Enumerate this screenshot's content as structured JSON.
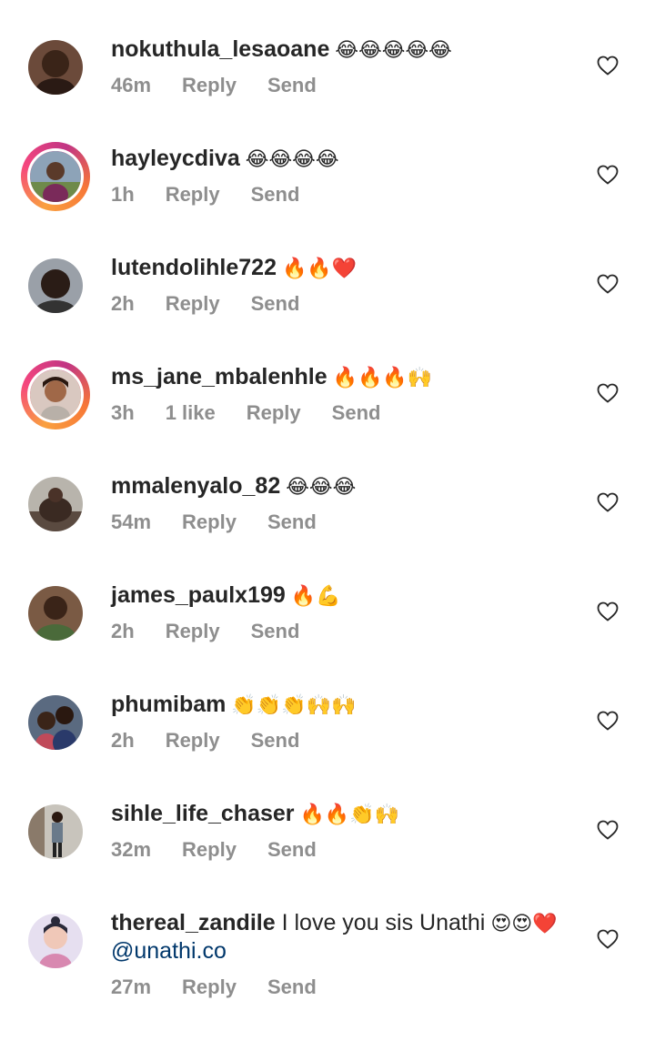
{
  "comments": [
    {
      "username": "nokuthula_lesaoane",
      "text": "",
      "emojis": "😂😂😂😂😂",
      "time": "46m",
      "likes": "",
      "reply": "Reply",
      "send": "Send",
      "ring": false,
      "mention": ""
    },
    {
      "username": "hayleycdiva",
      "text": "",
      "emojis": "😂😂😂😂",
      "time": "1h",
      "likes": "",
      "reply": "Reply",
      "send": "Send",
      "ring": true,
      "mention": ""
    },
    {
      "username": "lutendolihle722",
      "text": "",
      "emojis": "🔥🔥❤️",
      "time": "2h",
      "likes": "",
      "reply": "Reply",
      "send": "Send",
      "ring": false,
      "mention": ""
    },
    {
      "username": "ms_jane_mbalenhle",
      "text": "",
      "emojis": "🔥🔥🔥🙌",
      "time": "3h",
      "likes": "1 like",
      "reply": "Reply",
      "send": "Send",
      "ring": true,
      "mention": ""
    },
    {
      "username": "mmalenyalo_82",
      "text": "",
      "emojis": "😂😂😂",
      "time": "54m",
      "likes": "",
      "reply": "Reply",
      "send": "Send",
      "ring": false,
      "mention": ""
    },
    {
      "username": "james_paulx199",
      "text": "",
      "emojis": "🔥💪",
      "time": "2h",
      "likes": "",
      "reply": "Reply",
      "send": "Send",
      "ring": false,
      "mention": ""
    },
    {
      "username": "phumibam",
      "text": "",
      "emojis": "👏👏👏🙌🙌",
      "time": "2h",
      "likes": "",
      "reply": "Reply",
      "send": "Send",
      "ring": false,
      "mention": ""
    },
    {
      "username": "sihle_life_chaser",
      "text": "",
      "emojis": "🔥🔥👏🙌",
      "time": "32m",
      "likes": "",
      "reply": "Reply",
      "send": "Send",
      "ring": false,
      "mention": ""
    },
    {
      "username": "thereal_zandile",
      "text": "I love you sis Unathi",
      "emojis": "😍😍❤️",
      "time": "27m",
      "likes": "",
      "reply": "Reply",
      "send": "Send",
      "ring": false,
      "mention": "@unathi.co"
    }
  ],
  "icons": {
    "like": "heart-outline-icon"
  },
  "colors": {
    "text": "#262626",
    "meta": "#8e8e8e",
    "mention": "#00376b",
    "ring_start": "#f9a03f",
    "ring_end": "#c13584"
  }
}
